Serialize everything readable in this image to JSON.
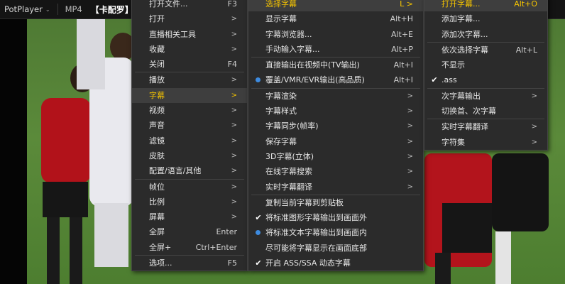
{
  "titlebar": {
    "app_name": "PotPlayer",
    "format": "MP4",
    "title": "【卡配罗】被"
  },
  "main_menu": {
    "items": [
      {
        "label": "打开文件...",
        "shortcut": "F3",
        "sub": false
      },
      {
        "label": "打开",
        "shortcut": "",
        "sub": true
      },
      {
        "label": "直播相关工具",
        "shortcut": "",
        "sub": true
      },
      {
        "label": "收藏",
        "shortcut": "",
        "sub": true
      },
      {
        "label": "关闭",
        "shortcut": "F4",
        "sub": false
      },
      {
        "sep": true
      },
      {
        "label": "播放",
        "shortcut": "",
        "sub": true
      },
      {
        "label": "字幕",
        "shortcut": "",
        "sub": true,
        "active": true
      },
      {
        "label": "视频",
        "shortcut": "",
        "sub": true
      },
      {
        "label": "声音",
        "shortcut": "",
        "sub": true
      },
      {
        "label": "滤镜",
        "shortcut": "",
        "sub": true
      },
      {
        "label": "皮肤",
        "shortcut": "",
        "sub": true
      },
      {
        "label": "配置/语言/其他",
        "shortcut": "",
        "sub": true
      },
      {
        "sep": true
      },
      {
        "label": "帧位",
        "shortcut": "",
        "sub": true
      },
      {
        "label": "比例",
        "shortcut": "",
        "sub": true
      },
      {
        "label": "屏幕",
        "shortcut": "",
        "sub": true
      },
      {
        "label": "全屏",
        "shortcut": "Enter",
        "sub": false
      },
      {
        "label": "全屏+",
        "shortcut": "Ctrl+Enter",
        "sub": false
      },
      {
        "sep": true
      },
      {
        "label": "选项...",
        "shortcut": "F5",
        "sub": false
      }
    ]
  },
  "subtitle_menu": {
    "items": [
      {
        "label": "选择字幕",
        "shortcut": "L >",
        "sub": false,
        "highlight": true
      },
      {
        "label": "显示字幕",
        "shortcut": "Alt+H",
        "sub": false
      },
      {
        "label": "字幕浏览器...",
        "shortcut": "Alt+E",
        "sub": false
      },
      {
        "label": "手动输入字幕...",
        "shortcut": "Alt+P",
        "sub": false
      },
      {
        "sep": true
      },
      {
        "label": "直接输出在视频中(TV输出)",
        "shortcut": "Alt+I",
        "sub": false
      },
      {
        "label": "覆盖/VMR/EVR输出(高品质)",
        "shortcut": "Alt+I",
        "sub": false,
        "mark": "dot"
      },
      {
        "sep": true
      },
      {
        "label": "字幕渲染",
        "shortcut": "",
        "sub": true
      },
      {
        "label": "字幕样式",
        "shortcut": "",
        "sub": true
      },
      {
        "label": "字幕同步(帧率)",
        "shortcut": "",
        "sub": true
      },
      {
        "label": "保存字幕",
        "shortcut": "",
        "sub": true
      },
      {
        "label": "3D字幕(立体)",
        "shortcut": "",
        "sub": true
      },
      {
        "label": "在线字幕搜索",
        "shortcut": "",
        "sub": true
      },
      {
        "label": "实时字幕翻译",
        "shortcut": "",
        "sub": true
      },
      {
        "sep": true
      },
      {
        "label": "复制当前字幕到剪贴板",
        "shortcut": "",
        "sub": false
      },
      {
        "label": "将标准图形字幕输出到画面外",
        "shortcut": "",
        "sub": false,
        "mark": "check"
      },
      {
        "label": "将标准文本字幕输出到画面内",
        "shortcut": "",
        "sub": false,
        "mark": "dot"
      },
      {
        "label": "尽可能将字幕显示在画面底部",
        "shortcut": "",
        "sub": false
      },
      {
        "label": "开启 ASS/SSA 动态字幕",
        "shortcut": "",
        "sub": false,
        "mark": "check"
      }
    ]
  },
  "select_menu": {
    "items": [
      {
        "label": "打开字幕...",
        "shortcut": "Alt+O",
        "sub": false,
        "highlight": true
      },
      {
        "label": "添加字幕...",
        "shortcut": "",
        "sub": false
      },
      {
        "label": "添加次字幕...",
        "shortcut": "",
        "sub": false
      },
      {
        "sep": true
      },
      {
        "label": "依次选择字幕",
        "shortcut": "Alt+L",
        "sub": false
      },
      {
        "label": "不显示",
        "shortcut": "",
        "sub": false
      },
      {
        "label": ".ass",
        "shortcut": "",
        "sub": false,
        "mark": "check"
      },
      {
        "sep": true
      },
      {
        "label": "次字幕输出",
        "shortcut": "",
        "sub": true
      },
      {
        "label": "切换首、次字幕",
        "shortcut": "",
        "sub": false
      },
      {
        "sep": true
      },
      {
        "label": "实时字幕翻译",
        "shortcut": "",
        "sub": true
      },
      {
        "label": "字符集",
        "shortcut": "",
        "sub": true
      }
    ]
  },
  "colors": {
    "highlight_text": "#f5c400",
    "menu_bg": "#2b2b2b",
    "radio_dot": "#3d8be0"
  },
  "icons": {
    "submenu": "chevron-right-icon",
    "check": "check-icon",
    "radio": "radio-dot-icon"
  }
}
